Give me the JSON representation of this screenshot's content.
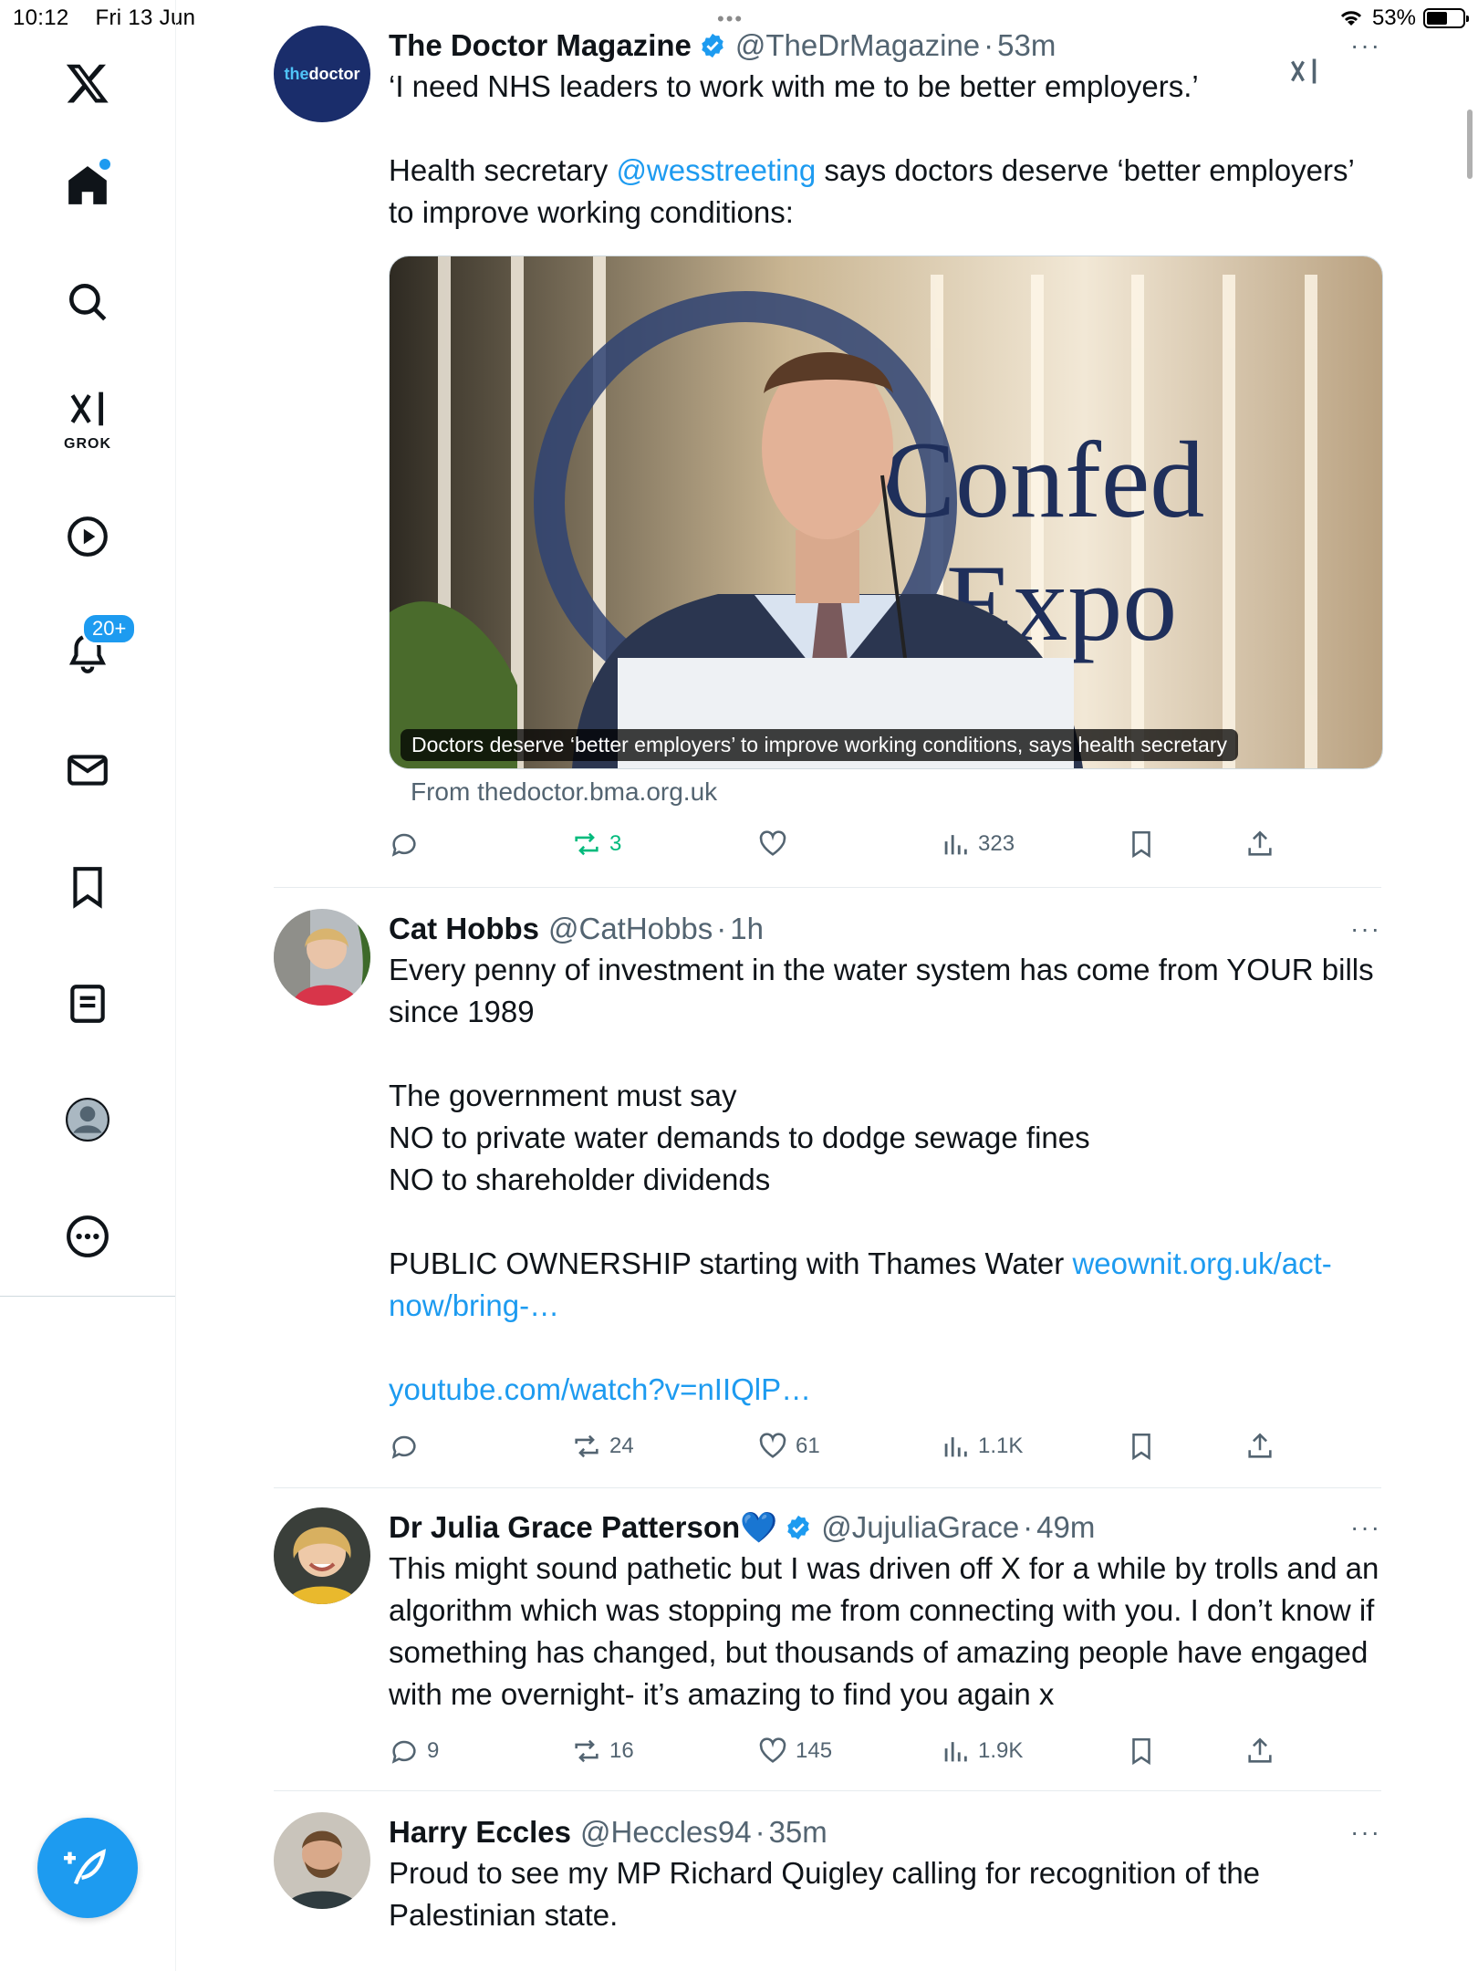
{
  "status_bar": {
    "time": "10:12",
    "date": "Fri 13 Jun",
    "battery": "53%"
  },
  "sidebar": {
    "items": [
      {
        "name": "x-logo"
      },
      {
        "name": "home"
      },
      {
        "name": "explore"
      },
      {
        "name": "grok",
        "label": "GROK"
      },
      {
        "name": "video"
      },
      {
        "name": "notifications",
        "badge": "20+"
      },
      {
        "name": "messages"
      },
      {
        "name": "bookmarks"
      },
      {
        "name": "lists"
      },
      {
        "name": "profile"
      },
      {
        "name": "more"
      }
    ]
  },
  "tweets": [
    {
      "name": "The Doctor Magazine",
      "handle": "@TheDrMagazine",
      "time": "53m",
      "verified": true,
      "avatar_text_a": "the",
      "avatar_text_b": "doctor",
      "text_1": "‘I need NHS leaders to work with me to be better employers.’",
      "text_2a": "Health secretary ",
      "mention": "@wesstreeting",
      "text_2b": " says doctors deserve ‘better employers’ to improve working conditions:",
      "card_caption": "Doctors deserve ‘better employers’ to improve working conditions, says health secretary",
      "card_from": "From thedoctor.bma.org.uk",
      "sign_text_a": "Confed",
      "sign_text_b": "Expo",
      "stats": {
        "replies": "",
        "reposts": "3",
        "likes": "",
        "views": "323"
      }
    },
    {
      "name": "Cat Hobbs",
      "handle": "@CatHobbs",
      "time": "1h",
      "verified": false,
      "text": "Every penny of investment in the water system has come from YOUR bills since 1989\n\nThe government must say\nNO to private water demands to dodge sewage fines\nNO to shareholder dividends\n\nPUBLIC OWNERSHIP starting with Thames Water ",
      "link_1": "weownit.org.uk/act-now/bring-…",
      "link_2": "youtube.com/watch?v=nIIQlP…",
      "stats": {
        "replies": "",
        "reposts": "24",
        "likes": "61",
        "views": "1.1K"
      }
    },
    {
      "name": "Dr Julia Grace Patterson",
      "name_emoji": "💙",
      "handle": "@JujuliaGrace",
      "time": "49m",
      "verified": true,
      "text": "This might sound pathetic but I was driven off X for a while by trolls and an algorithm which was stopping me from connecting with you. I don’t know if something has changed, but thousands of amazing people have engaged with me overnight- it’s amazing to find you again x",
      "stats": {
        "replies": "9",
        "reposts": "16",
        "likes": "145",
        "views": "1.9K"
      }
    },
    {
      "name": "Harry Eccles",
      "handle": "@Heccles94",
      "time": "35m",
      "verified": false,
      "text": "Proud to see my MP Richard Quigley calling for recognition of the Palestinian state."
    }
  ],
  "colors": {
    "accent": "#1d9bf0",
    "repost_active": "#00ba7c",
    "secondary_text": "#536471"
  }
}
